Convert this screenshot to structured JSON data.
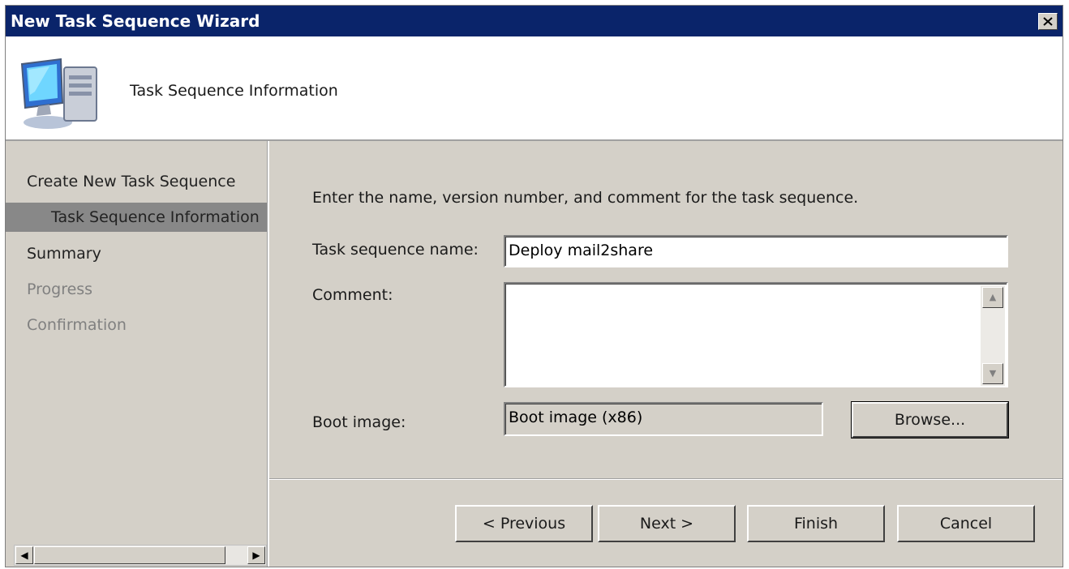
{
  "window": {
    "title": "New Task Sequence Wizard"
  },
  "header": {
    "title": "Task Sequence Information",
    "icon": "computer-icon"
  },
  "nav": {
    "items": [
      {
        "label": "Create New Task Sequence"
      },
      {
        "label": "Task Sequence Information"
      },
      {
        "label": "Summary"
      },
      {
        "label": "Progress"
      },
      {
        "label": "Confirmation"
      }
    ]
  },
  "form": {
    "instruction": "Enter the name, version number, and comment for the task sequence.",
    "name_label": "Task sequence name:",
    "name_value": "Deploy mail2share",
    "comment_label": "Comment:",
    "comment_value": "",
    "boot_label": "Boot image:",
    "boot_value": "Boot image (x86)",
    "browse_label": "Browse..."
  },
  "buttons": {
    "previous": "< Previous",
    "next": "Next >",
    "finish": "Finish",
    "cancel": "Cancel"
  },
  "colors": {
    "titlebar": "#0a246a",
    "face": "#d4d0c8",
    "selected": "#888888"
  }
}
